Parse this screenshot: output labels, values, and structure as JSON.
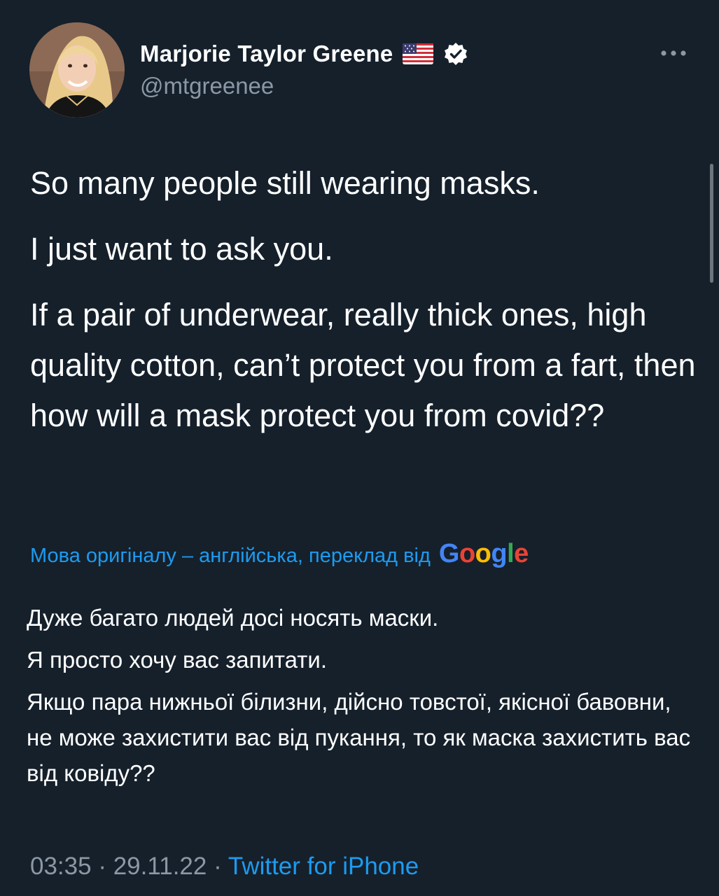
{
  "user": {
    "display_name": "Marjorie Taylor Greene",
    "handle": "@mtgreenee",
    "flag_icon": "us-flag-icon",
    "verified_icon": "verified-badge-icon",
    "avatar_icon": "profile-photo",
    "more_icon": "more-options-icon"
  },
  "tweet": {
    "paragraphs": [
      "So many people still wearing masks.",
      "I just want to ask you.",
      "If a pair of underwear, really thick ones, high quality cotton, can’t protect you from a fart, then how will a mask protect you from covid??"
    ]
  },
  "translation": {
    "note": "Мова оригіналу – англійська, переклад від",
    "provider": "Google",
    "paragraphs": [
      "Дуже багато людей досі носять маски.",
      "Я просто хочу вас запитати.",
      "Якщо пара нижньої білизни, дійсно товстої, якісної бавовни, не може захистити вас від пукання, то як маска захистить вас від ковіду??"
    ]
  },
  "meta": {
    "time": "03:35",
    "separator": "·",
    "date": "29.11.22",
    "source": "Twitter for iPhone"
  },
  "colors": {
    "background": "#15202b",
    "link_blue": "#1d9bf0",
    "secondary_text": "#8b98a5",
    "google_blue": "#4285f4",
    "google_red": "#ea4335",
    "google_yellow": "#fbbc05",
    "google_green": "#34a853"
  }
}
